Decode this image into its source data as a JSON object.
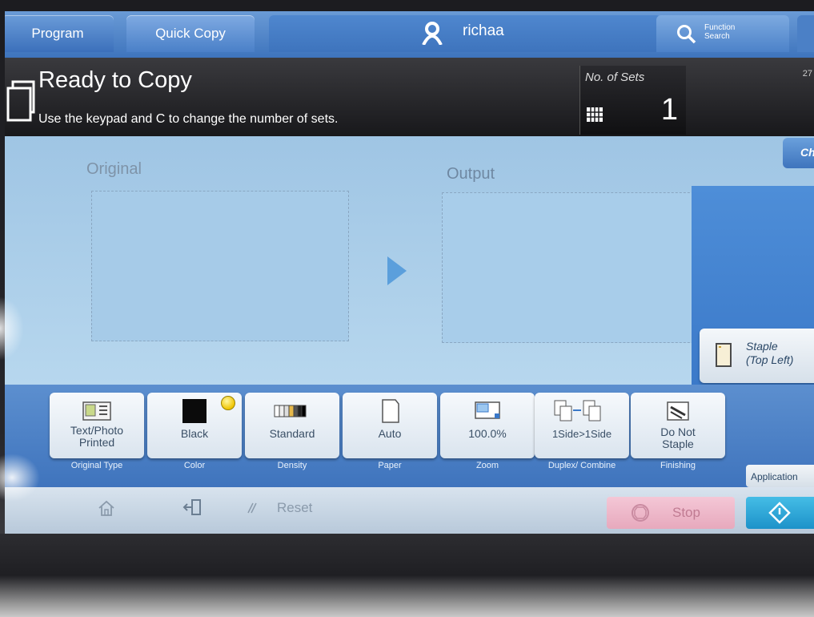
{
  "tabs": {
    "program": "Program",
    "quick_copy": "Quick Copy",
    "user_name": "richaa",
    "function_search": "Function\nSearch"
  },
  "message": {
    "title": "Ready to Copy",
    "subtitle": "Use the keypad and C to change the number of sets.",
    "sets_label": "No. of Sets",
    "sets_value": "1",
    "corner_number": "27"
  },
  "preview": {
    "original_label": "Original",
    "output_label": "Output",
    "top_right_button": "Ch",
    "staple_label": "Staple\n(Top Left)"
  },
  "functions": [
    {
      "label": "Text/Photo\nPrinted",
      "caption": "Original Type",
      "icon": "document-text-photo-icon"
    },
    {
      "label": "Black",
      "caption": "Color",
      "icon": "black-color-swatch-icon"
    },
    {
      "label": "Standard",
      "caption": "Density",
      "icon": "density-scale-icon"
    },
    {
      "label": "Auto",
      "caption": "Paper",
      "icon": "paper-sheet-icon"
    },
    {
      "label": "100.0%",
      "caption": "Zoom",
      "icon": "zoom-icon"
    },
    {
      "label": "1Side>1Side",
      "caption": "Duplex/\nCombine",
      "icon": "duplex-icon"
    },
    {
      "label": "Do Not\nStaple",
      "caption": "Finishing",
      "icon": "finishing-icon"
    }
  ],
  "application_button": "Application",
  "bottom": {
    "reset_label": "Reset",
    "stop_label": "Stop"
  },
  "colors": {
    "accent_blue": "#3e74bd",
    "screen_bg": "#a9cce6",
    "stop_pink": "#e7a9bd",
    "start_cyan": "#1d92c9"
  }
}
